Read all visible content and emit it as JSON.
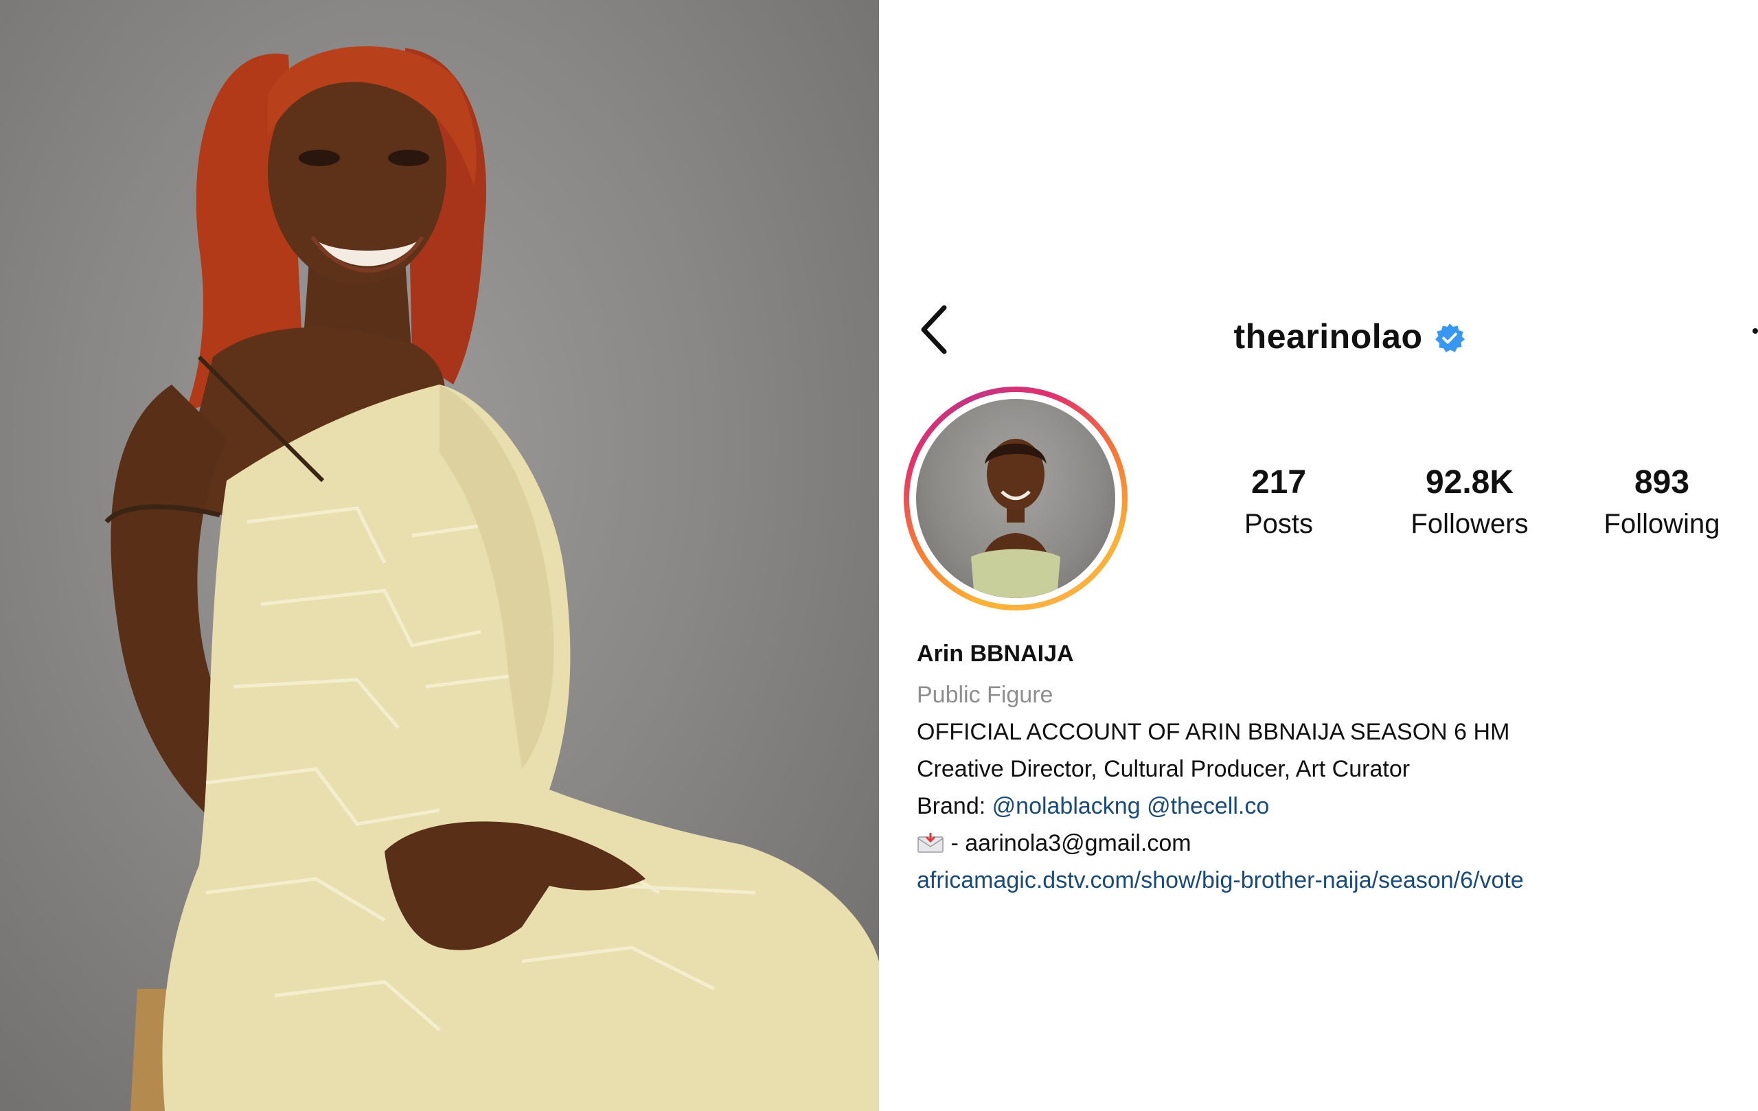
{
  "profile": {
    "username": "thearinolao",
    "stats": [
      {
        "value": "217",
        "label": "Posts"
      },
      {
        "value": "92.8K",
        "label": "Followers"
      },
      {
        "value": "893",
        "label": "Following"
      }
    ],
    "bio": {
      "name": "Arin BBNAIJA",
      "category": "Public Figure",
      "line1": "OFFICIAL ACCOUNT OF ARIN BBNAIJA SEASON 6 HM",
      "line2": "Creative Director, Cultural Producer, Art Curator",
      "brand_prefix": "Brand:",
      "brand_handle_1": "@nolablackng",
      "brand_handle_2": "@thecell.co",
      "email_text": "- aarinola3@gmail.com",
      "website": "africamagic.dstv.com/show/big-brother-naija/season/6/vote"
    }
  },
  "icons": {
    "back": "chevron-left-icon",
    "verified": "verified-badge-icon",
    "mail": "envelope-icon",
    "more": "more-icon"
  },
  "colors": {
    "verified_blue": "#3897f0",
    "link_blue": "#1a4a7a",
    "category_gray": "#8e8e8e",
    "story_ring": [
      "#f9b233",
      "#f77737",
      "#e1306c",
      "#c13584"
    ]
  }
}
